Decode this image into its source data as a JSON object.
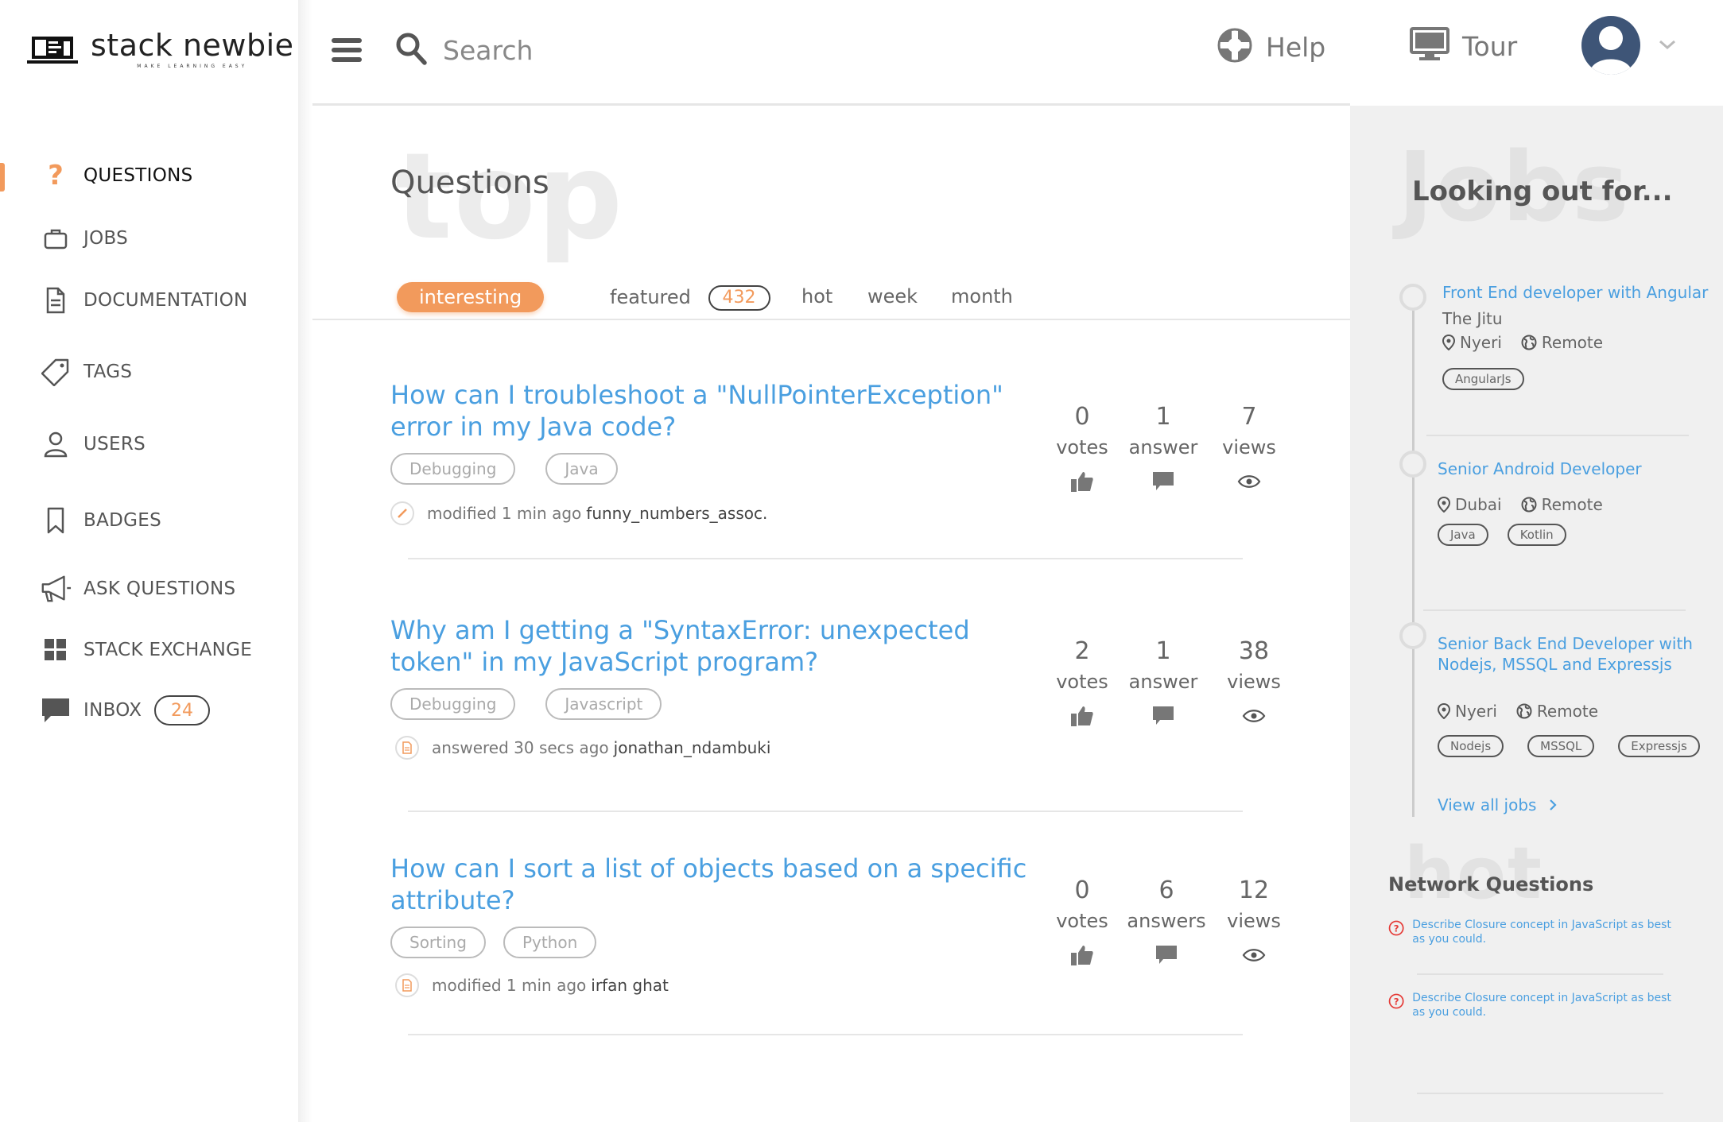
{
  "brand": {
    "name": "stack newbie",
    "tagline": "MAKE LEARNING EASY"
  },
  "sidebar": {
    "items": [
      {
        "label": "QUESTIONS",
        "icon": "question-icon",
        "active": true
      },
      {
        "label": "JOBS",
        "icon": "briefcase-icon"
      },
      {
        "label": "DOCUMENTATION",
        "icon": "document-icon"
      },
      {
        "label": "TAGS",
        "icon": "tag-icon"
      },
      {
        "label": "USERS",
        "icon": "user-icon"
      },
      {
        "label": "BADGES",
        "icon": "bookmark-icon"
      },
      {
        "label": "ASK QUESTIONS",
        "icon": "megaphone-icon"
      },
      {
        "label": "STACK EXCHANGE",
        "icon": "grid-icon"
      },
      {
        "label": "INBOX",
        "icon": "chat-icon",
        "badge": "24"
      }
    ]
  },
  "topbar": {
    "search_placeholder": "Search",
    "help_label": "Help",
    "tour_label": "Tour"
  },
  "main": {
    "bg_word": "top",
    "title": "Questions",
    "tabs": [
      {
        "label": "interesting",
        "active": true
      },
      {
        "label": "featured",
        "badge": "432"
      },
      {
        "label": "hot"
      },
      {
        "label": "week"
      },
      {
        "label": "month"
      }
    ],
    "questions": [
      {
        "title": "How can I troubleshoot a \"NullPointerException\" error in my Java code?",
        "tags": [
          "Debugging",
          "Java"
        ],
        "meta_action": "modified 1 min ago",
        "meta_user": "funny_numbers_assoc.",
        "meta_icon": "pencil-icon",
        "votes": "0",
        "votes_label": "votes",
        "answers": "1",
        "answers_label": "answer",
        "views": "7",
        "views_label": "views"
      },
      {
        "title": "Why am I getting a \"SyntaxError: unexpected token\" in my JavaScript program?",
        "tags": [
          "Debugging",
          "Javascript"
        ],
        "meta_action": "answered 30 secs ago",
        "meta_user": "jonathan_ndambuki",
        "meta_icon": "file-icon",
        "votes": "2",
        "votes_label": "votes",
        "answers": "1",
        "answers_label": "answer",
        "views": "38",
        "views_label": "views"
      },
      {
        "title": "How can I sort a list of objects based on a specific attribute?",
        "tags": [
          "Sorting",
          "Python"
        ],
        "meta_action": "modified 1 min ago",
        "meta_user": "irfan ghat",
        "meta_icon": "file-icon",
        "votes": "0",
        "votes_label": "votes",
        "answers": "6",
        "answers_label": "answers",
        "views": "12",
        "views_label": "views"
      }
    ]
  },
  "right": {
    "bg_word": "Jobs",
    "title": "Looking out for...",
    "jobs": [
      {
        "title": "Front End developer with Angular",
        "company": "The Jitu",
        "location": "Nyeri",
        "remote": "Remote",
        "tags": [
          "AngularJs"
        ]
      },
      {
        "title": "Senior Android Developer",
        "company": "",
        "location": "Dubai",
        "remote": "Remote",
        "tags": [
          "Java",
          "Kotlin"
        ]
      },
      {
        "title": "Senior Back End Developer with Nodejs, MSSQL and Expressjs",
        "company": "",
        "location": "Nyeri",
        "remote": "Remote",
        "tags": [
          "Nodejs",
          "MSSQL",
          "Expressjs"
        ]
      }
    ],
    "view_all": "View all jobs",
    "network_bg_word": "hot",
    "network_title": "Network Questions",
    "network_questions": [
      "Describe Closure concept in JavaScript as best as you could.",
      "Describe Closure concept in JavaScript as best as you could."
    ]
  },
  "colors": {
    "accent": "#f29a5c",
    "link": "#4a9fe0",
    "avatar": "#3e5577",
    "alert": "#e53935"
  }
}
